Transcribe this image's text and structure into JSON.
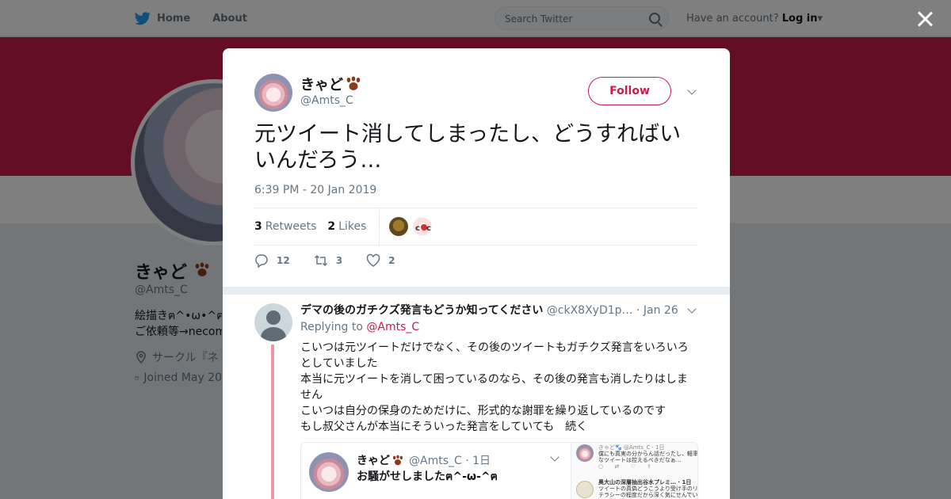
{
  "topbar": {
    "home_label": "Home",
    "about_label": "About",
    "search_placeholder": "Search Twitter",
    "account_prompt": "Have an account?",
    "login_label": "Log in"
  },
  "profile": {
    "name": "きゃど",
    "handle": "@Amts_C",
    "bio_line1": "絵描きฅ^•ω•^ฅ pix",
    "bio_line2": "ご依頼等→necom",
    "location": "サークル『ネ",
    "joined": "Joined May 20"
  },
  "tweet": {
    "author_name": "きゃど",
    "author_handle": "@Amts_C",
    "follow_label": "Follow",
    "text": "元ツイート消してしまったし、どうすればいいんだろう…",
    "timestamp": "6:39 PM - 20 Jan 2019",
    "retweets_count": "3",
    "retweets_label": "Retweets",
    "likes_count": "2",
    "likes_label": "Likes",
    "reply_count": "12",
    "retweet_action_count": "3",
    "like_action_count": "2"
  },
  "reply": {
    "author_name": "デマの後のガチクズ発言もどうか知ってください",
    "author_handle": "@ckX8XyD1p…",
    "date": "· Jan 26",
    "replying_to_label": "Replying to",
    "replying_to_handle": "@Amts_C",
    "body_lines": [
      "こいつは元ツイートだけでなく、その後のツイートもガチクズ発言をいろいろ",
      "としていました",
      "本当に元ツイートを消して困っているのなら、その後の発言も消したりはしま",
      "せん",
      "こいつは自分の保身のためだけに、形式的な謝罪を繰り返しているのです",
      "もし叔父さんが本当にそういった発言をしていても　続く"
    ],
    "quote": {
      "name": "きゃど",
      "handle_date": "@Amts_C · 1日",
      "text": "お騒がせしましたฅ^-ω-^ฅ"
    },
    "screenshot": {
      "row1_lines": [
        "きゃど🐾 @Amts_C · 1日",
        "僕にも真実の分からん話だったし、軽率",
        "なツイートは控えるべきだなぁ…"
      ],
      "row2_lines": [
        "奥大山の深層抽出谷水プレミ… · 1日",
        "ツイートの真偽どうこうより受け手のリ",
        "テラシーの程度だから深く気にせんでい"
      ]
    }
  },
  "colors": {
    "accent": "#c81d4a",
    "thread_line": "#ed95a8",
    "banner": "#c81d4a",
    "twitter_blue": "#1da1f2"
  },
  "icons": [
    "twitter-bird-icon",
    "search-icon",
    "close-icon",
    "paw-icon",
    "chevron-down-icon",
    "reply-icon",
    "retweet-icon",
    "heart-icon",
    "location-icon",
    "calendar-icon"
  ]
}
